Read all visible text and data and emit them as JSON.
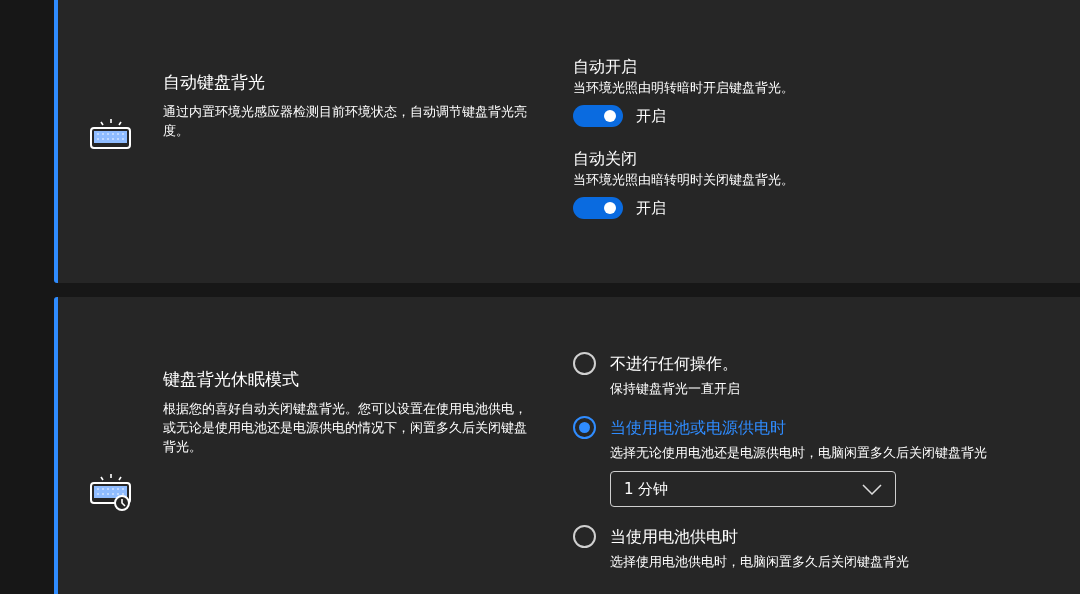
{
  "auto_backlight": {
    "title": "自动键盘背光",
    "description": "通过内置环境光感应器检测目前环境状态，自动调节键盘背光亮度。",
    "toggles": [
      {
        "label": "自动开启",
        "description": "当环境光照由明转暗时开启键盘背光。",
        "on": true,
        "state_text": "开启"
      },
      {
        "label": "自动关闭",
        "description": "当环境光照由暗转明时关闭键盘背光。",
        "on": true,
        "state_text": "开启"
      }
    ]
  },
  "sleep_mode": {
    "title": "键盘背光休眠模式",
    "description": "根据您的喜好自动关闭键盘背光。您可以设置在使用电池供电，或无论是使用电池还是电源供电的情况下，闲置多久后关闭键盘背光。",
    "options": [
      {
        "label": "不进行任何操作。",
        "description": "保持键盘背光一直开启",
        "selected": false
      },
      {
        "label": "当使用电池或电源供电时",
        "description": "选择无论使用电池还是电源供电时，电脑闲置多久后关闭键盘背光",
        "selected": true,
        "dropdown": {
          "value": "1 分钟"
        }
      },
      {
        "label": "当使用电池供电时",
        "description": "选择使用电池供电时，电脑闲置多久后关闭键盘背光",
        "selected": false
      }
    ]
  }
}
